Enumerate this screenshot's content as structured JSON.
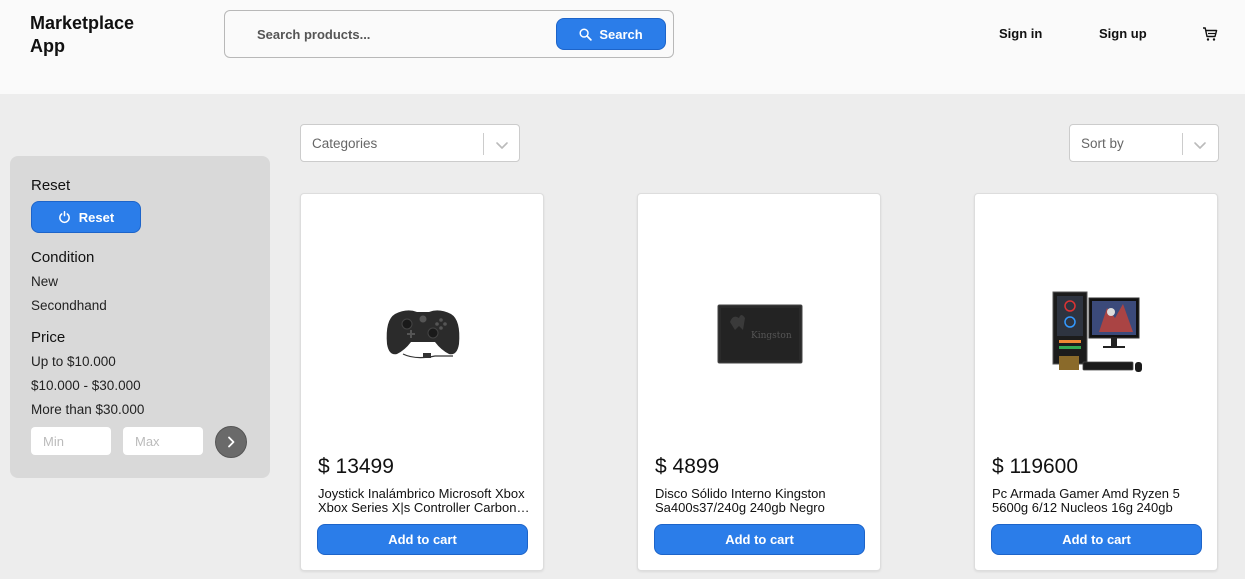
{
  "header": {
    "app_title": "Marketplace App",
    "search": {
      "placeholder": "Search products...",
      "value": "",
      "button_label": "Search"
    },
    "sign_in": "Sign in",
    "sign_up": "Sign up",
    "cart_icon": "cart-icon"
  },
  "filters": {
    "reset_heading": "Reset",
    "reset_button": "Reset",
    "condition_heading": "Condition",
    "condition_options": [
      "New",
      "Secondhand"
    ],
    "price_heading": "Price",
    "price_options": [
      "Up to $10.000",
      "$10.000 - $30.000",
      "More than $30.000"
    ],
    "min_placeholder": "Min",
    "max_placeholder": "Max"
  },
  "toolbar": {
    "categories_label": "Categories",
    "sort_label": "Sort by"
  },
  "products": [
    {
      "price": "$ 13499",
      "title": "Joystick Inalámbrico Microsoft Xbox Xbox Series X|s Controller Carbon Black",
      "add_label": "Add to cart",
      "image_icon": "xbox-controller-icon"
    },
    {
      "price": "$ 4899",
      "title": "Disco Sólido Interno Kingston Sa400s37/240g 240gb Negro",
      "add_label": "Add to cart",
      "image_icon": "ssd-drive-icon",
      "brand_text": "Kingston"
    },
    {
      "price": "$ 119600",
      "title": "Pc Armada Gamer Amd Ryzen 5 5600g 6/12 Nucleos 16g 240gb",
      "add_label": "Add to cart",
      "image_icon": "gaming-pc-icon"
    }
  ],
  "colors": {
    "accent": "#2b7de9",
    "header_bg": "#fafafa",
    "page_bg": "#ededed",
    "filter_bg": "#d9d9d9"
  }
}
